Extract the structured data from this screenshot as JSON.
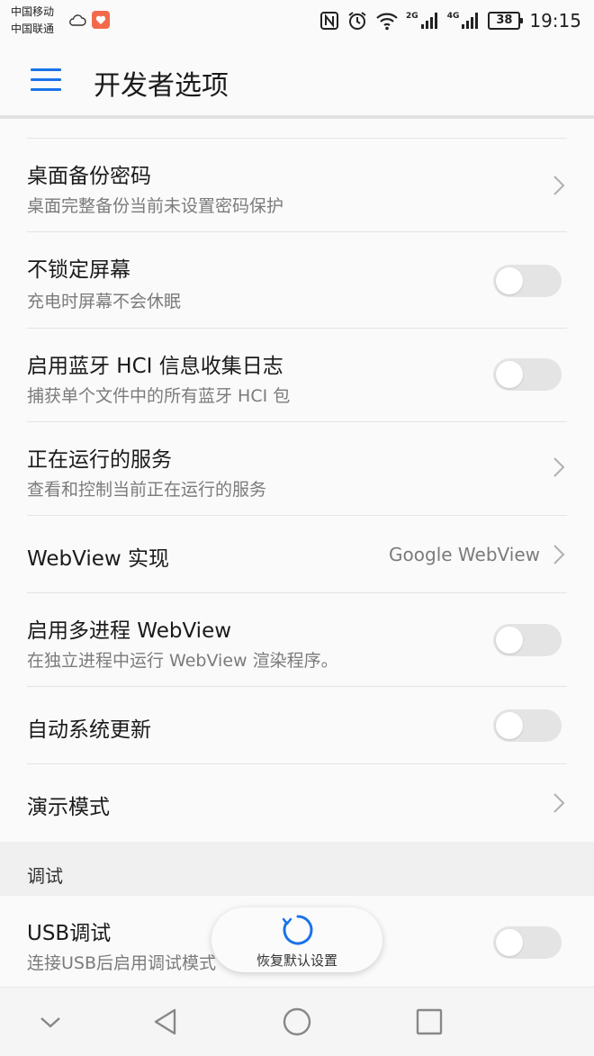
{
  "status_bar": {
    "carrier_1": "中国移动",
    "carrier_2": "中国联通",
    "net_2g": "2G",
    "net_4g": "4G",
    "battery": "38",
    "time": "19:15",
    "icons": [
      "weather-cloud-icon",
      "app-badge-icon",
      "nfc-icon",
      "alarm-icon",
      "wifi-icon",
      "signal-icon",
      "signal-icon",
      "battery-icon"
    ]
  },
  "toolbar": {
    "menu_icon": "hamburger-menu-icon",
    "title": "开发者选项"
  },
  "rows": {
    "desktop_backup": {
      "title": "桌面备份密码",
      "subtitle": "桌面完整备份当前未设置密码保护"
    },
    "stay_awake": {
      "title": "不锁定屏幕",
      "subtitle": "充电时屏幕不会休眠",
      "toggle_on": false
    },
    "bt_hci_log": {
      "title": "启用蓝牙 HCI 信息收集日志",
      "subtitle": "捕获单个文件中的所有蓝牙 HCI 包",
      "toggle_on": false
    },
    "running_services": {
      "title": "正在运行的服务",
      "subtitle": "查看和控制当前正在运行的服务"
    },
    "webview_impl": {
      "title": "WebView 实现",
      "value": "Google WebView"
    },
    "multiprocess_webview": {
      "title": "启用多进程 WebView",
      "subtitle": "在独立进程中运行 WebView 渲染程序。",
      "toggle_on": false
    },
    "auto_update": {
      "title": "自动系统更新",
      "toggle_on": false
    },
    "demo_mode": {
      "title": "演示模式"
    }
  },
  "section_debug": {
    "header": "调试",
    "usb_debugging": {
      "title": "USB调试",
      "subtitle": "连接USB后启用调试模式",
      "toggle_on": false
    }
  },
  "toast": {
    "label": "恢复默认设置",
    "icon": "refresh-spinner-icon"
  },
  "nav_bar": {
    "icons": [
      "collapse-down-icon",
      "back-icon",
      "home-icon",
      "recents-icon"
    ]
  },
  "colors": {
    "accent": "#1a73e8",
    "toggle_off_track": "#e4e4e4",
    "toast_spinner": "#1a73e8"
  }
}
